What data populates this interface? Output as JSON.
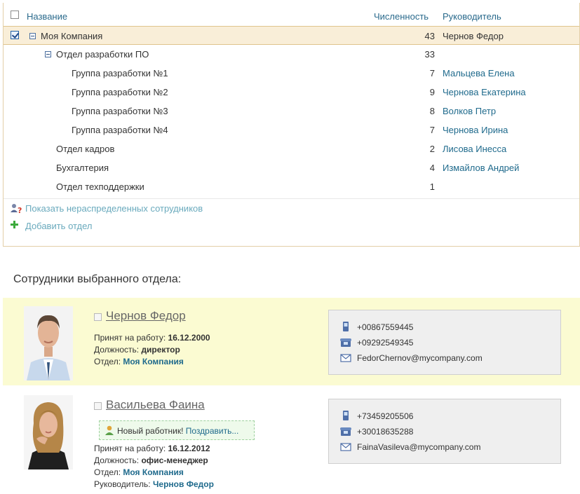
{
  "departments": {
    "columns": {
      "name": "Название",
      "count": "Численность",
      "head": "Руководитель"
    },
    "rows": [
      {
        "name": "Моя Компания",
        "count": "43",
        "head": "Чернов Федор"
      },
      {
        "name": "Отдел разработки ПО",
        "count": "33",
        "head": ""
      },
      {
        "name": "Группа разработки №1",
        "count": "7",
        "head": "Мальцева Елена"
      },
      {
        "name": "Группа разработки №2",
        "count": "9",
        "head": "Чернова Екатерина"
      },
      {
        "name": "Группа разработки №3",
        "count": "8",
        "head": "Волков Петр"
      },
      {
        "name": "Группа разработки №4",
        "count": "7",
        "head": "Чернова Ирина"
      },
      {
        "name": "Отдел кадров",
        "count": "2",
        "head": "Лисова Инесса"
      },
      {
        "name": "Бухгалтерия",
        "count": "4",
        "head": "Измайлов Андрей"
      },
      {
        "name": "Отдел техподдержки",
        "count": "1",
        "head": ""
      }
    ],
    "actions": {
      "show_unassigned": "Показать нераспределенных сотрудников",
      "add_department": "Добавить отдел"
    }
  },
  "employees_section": {
    "title": "Сотрудники выбранного отдела:",
    "employees": [
      {
        "name": "Чернов Федор",
        "hired_label": "Принят на работу:",
        "hired": "16.12.2000",
        "position_label": "Должность:",
        "position": "директор",
        "dept_label": "Отдел:",
        "dept": "Моя Компания",
        "phone_mobile": "+00867559445",
        "phone_work": "+09292549345",
        "email": "FedorChernov@mycompany.com"
      },
      {
        "name": "Васильева Фаина",
        "new_badge": "Новый работник!",
        "congratulate": "Поздравить...",
        "hired_label": "Принят на работу:",
        "hired": "16.12.2012",
        "position_label": "Должность:",
        "position": "офис-менеджер",
        "dept_label": "Отдел:",
        "dept": "Моя Компания",
        "manager_label": "Руководитель:",
        "manager": "Чернов Федор",
        "phone_mobile": "+73459205506",
        "phone_work": "+30018635288",
        "email": "FainaVasileva@mycompany.com"
      }
    ]
  },
  "colors": {
    "link": "#1f6a8c",
    "selected_row": "#f9eed8",
    "highlight_card": "#fbfbd2",
    "action_link": "#6aaabd"
  }
}
